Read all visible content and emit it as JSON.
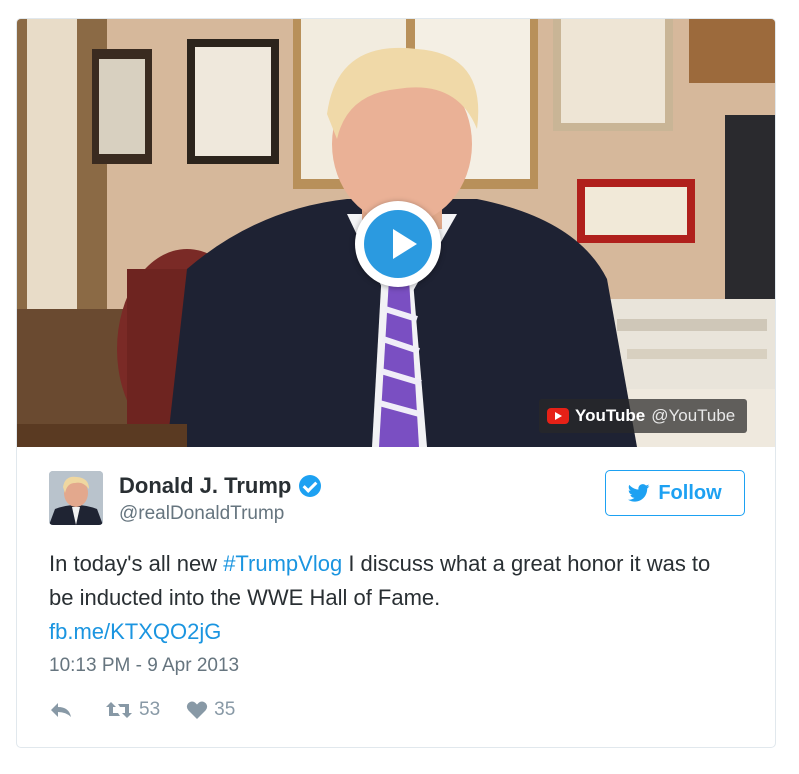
{
  "media": {
    "badge_channel": "YouTube",
    "badge_handle": "@YouTube"
  },
  "author": {
    "name": "Donald J. Trump",
    "handle": "@realDonaldTrump"
  },
  "follow_label": "Follow",
  "tweet": {
    "text_before": "In today's all new ",
    "hashtag": "#TrumpVlog",
    "text_after": " I discuss what a great honor it was to be inducted into the WWE Hall of Fame.",
    "link": "fb.me/KTXQO2jG"
  },
  "timestamp": "10:13 PM - 9 Apr 2013",
  "stats": {
    "retweets": "53",
    "likes": "35"
  },
  "colors": {
    "accent": "#1da1f2",
    "link": "#1b95e0",
    "text": "#292f33",
    "muted": "#66757f",
    "youtube_red": "#e62117"
  }
}
